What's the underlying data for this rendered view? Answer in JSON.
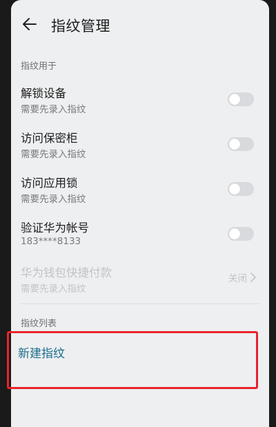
{
  "header": {
    "title": "指纹管理",
    "back_icon": "arrow-left-icon"
  },
  "sections": {
    "usage_header": "指纹用于",
    "list_header": "指纹列表"
  },
  "usage_items": [
    {
      "title": "解锁设备",
      "subtitle": "需要先录入指纹",
      "toggle": "off"
    },
    {
      "title": "访问保密柜",
      "subtitle": "需要先录入指纹",
      "toggle": "off"
    },
    {
      "title": "访问应用锁",
      "subtitle": "需要先录入指纹",
      "toggle": "off"
    },
    {
      "title": "验证华为帐号",
      "subtitle": "183****8133",
      "toggle": "off"
    }
  ],
  "wallet_item": {
    "title": "华为钱包快捷付款",
    "subtitle": "需要先录入指纹",
    "value": "关闭",
    "icon": "chevron-right-icon",
    "disabled": true
  },
  "new_fingerprint": {
    "label": "新建指纹"
  },
  "colors": {
    "accent": "#1f6e8c",
    "highlight": "#e8232b",
    "toggle_off": "#d9dadd",
    "background": "#eeeff1"
  }
}
